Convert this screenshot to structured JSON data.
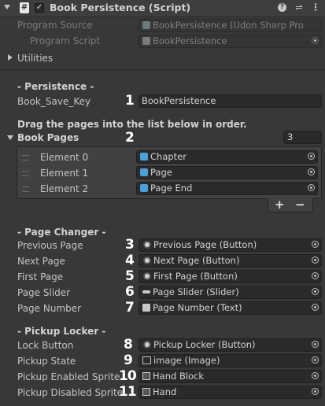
{
  "header": {
    "title": "Book Persistence (Script)",
    "icons": [
      "help-icon",
      "settings-icon",
      "menu-icon"
    ]
  },
  "program_source": {
    "label": "Program Source",
    "value": "BookPersistence (Udon Sharp Pro"
  },
  "program_script": {
    "label": "Program Script",
    "value": "BookPersistence"
  },
  "utilities": {
    "label": "Utilities"
  },
  "persistence": {
    "title": "- Persistence -",
    "save_key_label": "Book_Save_Key",
    "save_key_value": "BookPersistence",
    "marker": "1"
  },
  "drag_hint": "Drag the pages into the list below in order.",
  "book_pages": {
    "label": "Book Pages",
    "marker": "2",
    "size": "3",
    "elements": [
      {
        "label": "Element 0",
        "value": "Chapter"
      },
      {
        "label": "Element 1",
        "value": "Page"
      },
      {
        "label": "Element 2",
        "value": "Page End"
      }
    ],
    "add": "+",
    "remove": "−"
  },
  "page_changer": {
    "title": "- Page Changer -",
    "fields": [
      {
        "label": "Previous Page",
        "marker": "3",
        "value": "Previous Page (Button)"
      },
      {
        "label": "Next Page",
        "marker": "4",
        "value": "Next Page (Button)"
      },
      {
        "label": "First Page",
        "marker": "5",
        "value": "First Page (Button)"
      },
      {
        "label": "Page Slider",
        "marker": "6",
        "value": "Page Slider (Slider)"
      },
      {
        "label": "Page Number",
        "marker": "7",
        "value": "Page Number (Text)"
      }
    ]
  },
  "pickup_locker": {
    "title": "- Pickup Locker -",
    "fields": [
      {
        "label": "Lock Button",
        "marker": "8",
        "value": "Pickup Locker (Button)"
      },
      {
        "label": "Pickup State",
        "marker": "9",
        "value": "image (Image)"
      },
      {
        "label": "Pickup Enabled Sprite",
        "marker": "10",
        "value": "Hand Block"
      },
      {
        "label": "Pickup Disabled Sprite",
        "marker": "11",
        "value": "Hand"
      }
    ]
  }
}
